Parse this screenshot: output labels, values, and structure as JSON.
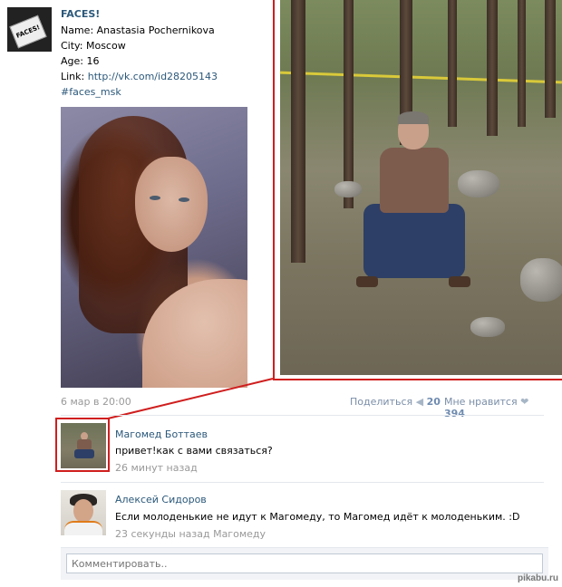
{
  "post": {
    "author": "FACES!",
    "avatar_caption": "FACES!",
    "name_label": "Name: ",
    "name_value": "Anastasia Pochernikova",
    "city_label": "City: ",
    "city_value": "Moscow",
    "age_label": "Age: ",
    "age_value": "16",
    "link_label": "Link: ",
    "link_value": "http://vk.com/id28205143",
    "hashtag": "#faces_msk",
    "date": "6 мар в 20:00",
    "share_label": "Поделиться",
    "share_count": "20",
    "like_label": "Мне нравится",
    "like_count": "394"
  },
  "comments": [
    {
      "author": "Магомед Боттаев",
      "text": "привет!как с вами связаться?",
      "time": "26 минут назад"
    },
    {
      "author": "Алексей Сидоров",
      "text": "Если молоденькие не идут к Магомеду, то Магомед идёт к молоденьким. :D",
      "time": "23 секунды назад",
      "reply_to": "Магомеду"
    }
  ],
  "comment_input": {
    "placeholder": "Комментировать.."
  },
  "watermark": "pikabu.ru",
  "colors": {
    "link": "#2b587a",
    "highlight_border": "#d01e1e",
    "muted": "#999999"
  }
}
